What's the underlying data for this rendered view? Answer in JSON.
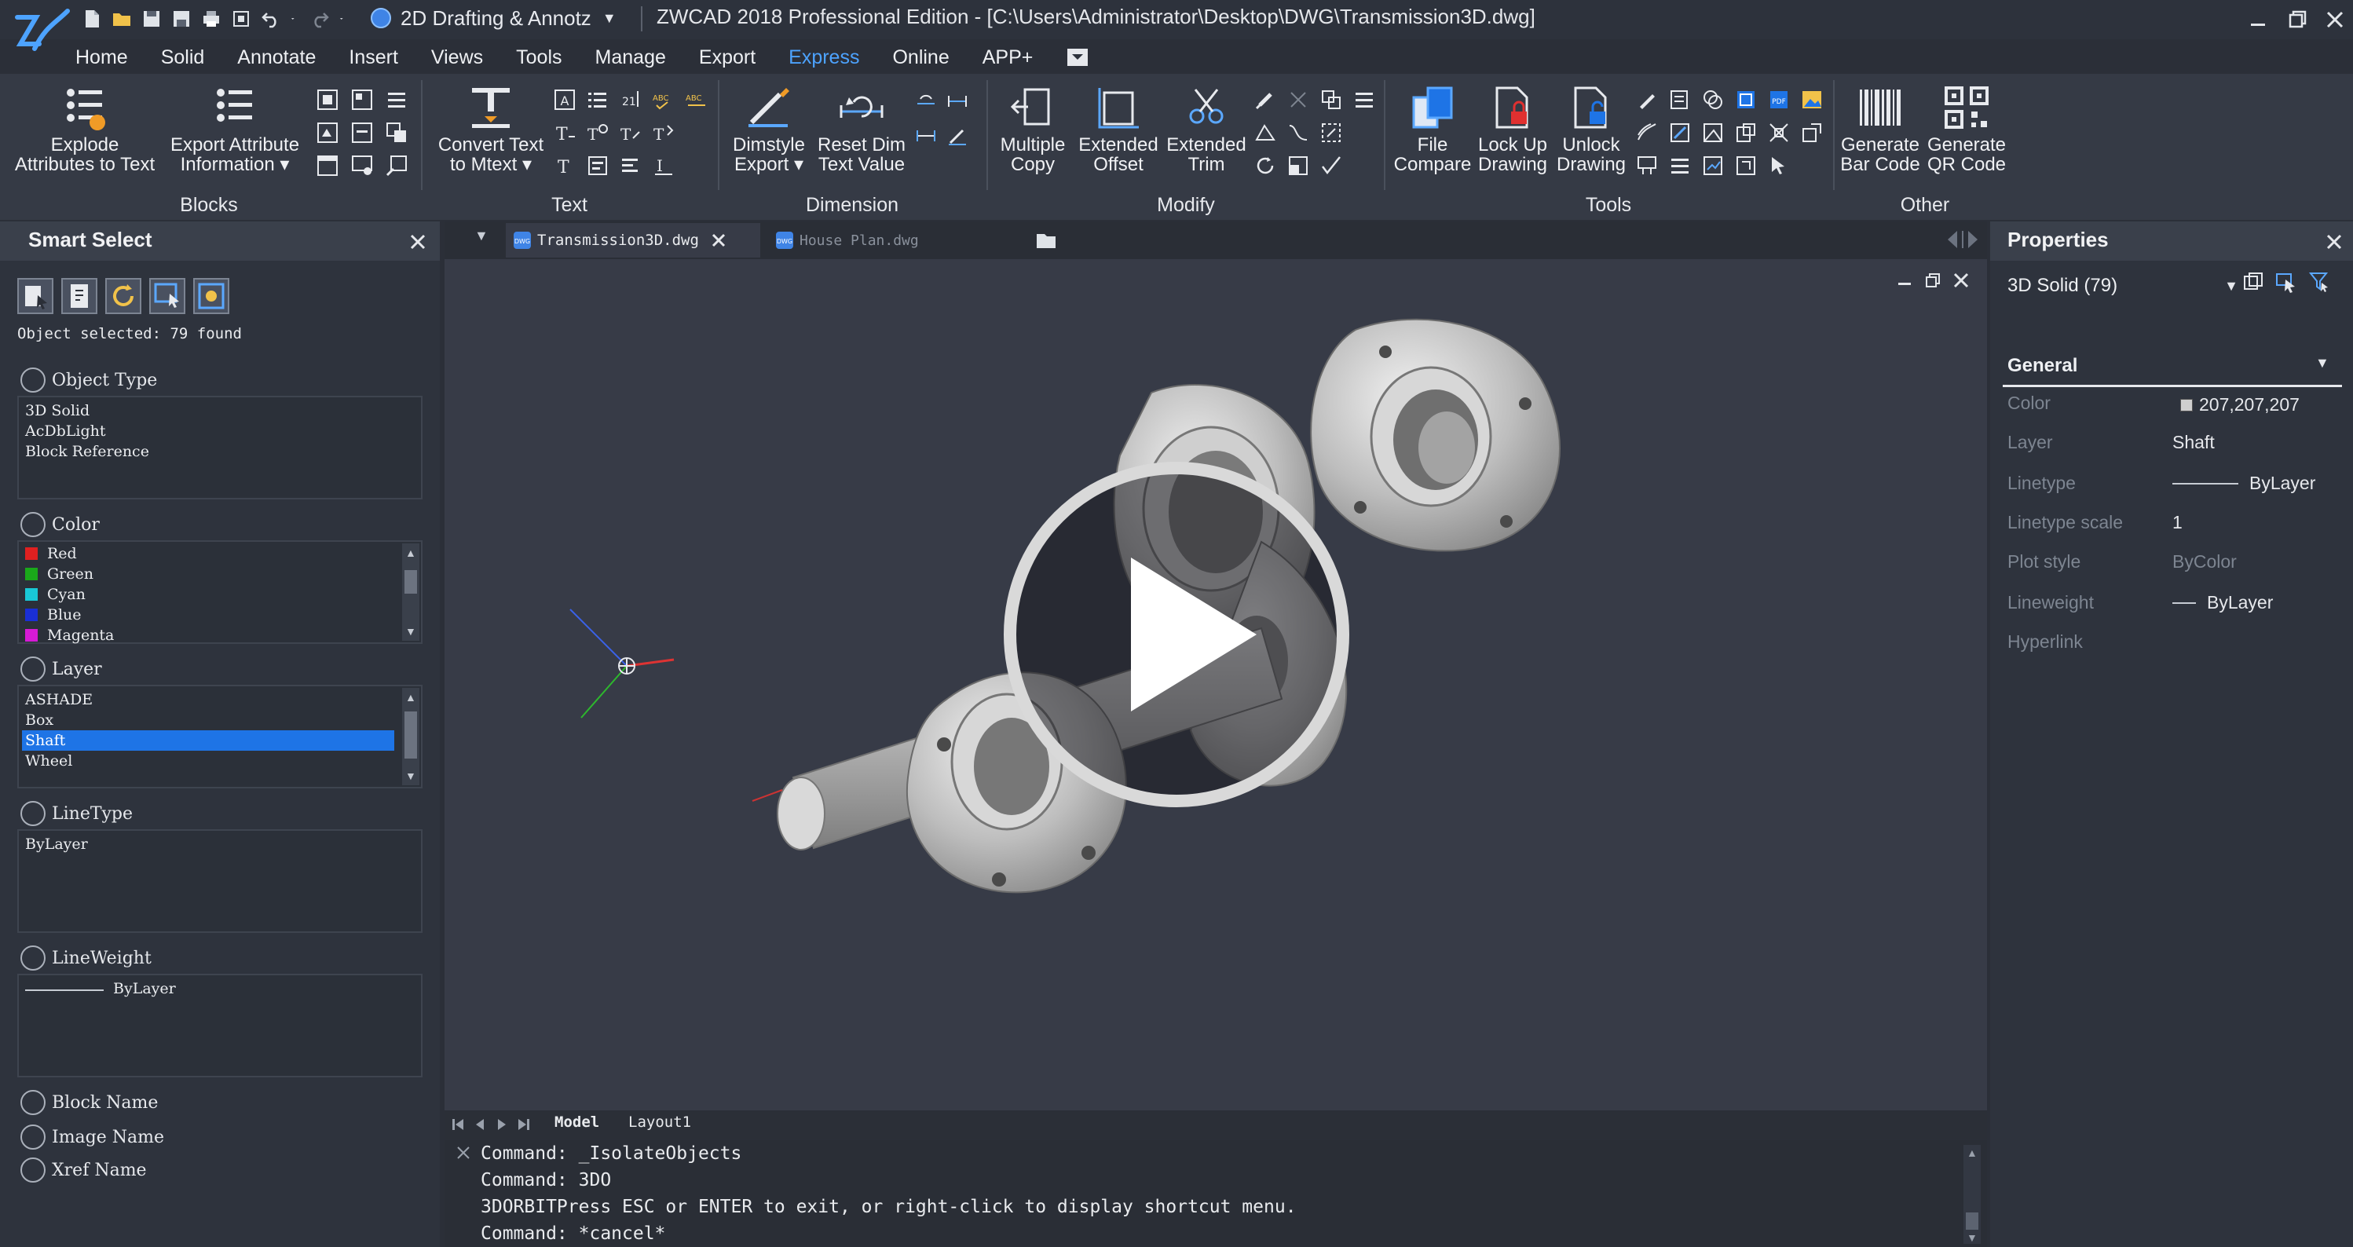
{
  "app": {
    "workspace": "2D Drafting & Annotz",
    "title": "ZWCAD 2018 Professional Edition - [C:\\Users\\Administrator\\Desktop\\DWG\\Transmission3D.dwg]"
  },
  "menu": {
    "items": [
      "Home",
      "Solid",
      "Annotate",
      "Insert",
      "Views",
      "Tools",
      "Manage",
      "Export",
      "Express",
      "Online",
      "APP+"
    ],
    "active": "Express"
  },
  "ribbon": {
    "blocks": {
      "label": "Blocks",
      "explode_line1": "Explode",
      "explode_line2": "Attributes to Text",
      "export_line1": "Export Attribute",
      "export_line2": "Information ▾"
    },
    "text": {
      "label": "Text",
      "convert_line1": "Convert Text",
      "convert_line2": "to Mtext ▾"
    },
    "dimension": {
      "label": "Dimension",
      "dimstyle_line1": "Dimstyle",
      "dimstyle_line2": "Export ▾",
      "reset_line1": "Reset Dim",
      "reset_line2": "Text Value"
    },
    "modify": {
      "label": "Modify",
      "multiple_line1": "Multiple",
      "multiple_line2": "Copy",
      "offset_line1": "Extended",
      "offset_line2": "Offset",
      "trim_line1": "Extended",
      "trim_line2": "Trim"
    },
    "tools": {
      "label": "Tools",
      "compare_line1": "File",
      "compare_line2": "Compare",
      "lock_line1": "Lock Up",
      "lock_line2": "Drawing",
      "unlock_line1": "Unlock",
      "unlock_line2": "Drawing"
    },
    "other": {
      "label": "Other",
      "barcode_line1": "Generate",
      "barcode_line2": "Bar Code",
      "qr_line1": "Generate",
      "qr_line2": "QR Code"
    }
  },
  "smart_select": {
    "title": "Smart Select",
    "status": "Object selected: 79 found",
    "object_type": {
      "label": "Object Type",
      "items": [
        "3D Solid",
        "AcDbLight",
        "Block Reference"
      ]
    },
    "color": {
      "label": "Color",
      "items": [
        {
          "name": "Red",
          "hex": "#e02020"
        },
        {
          "name": "Green",
          "hex": "#1aa81a"
        },
        {
          "name": "Cyan",
          "hex": "#19c8d6"
        },
        {
          "name": "Blue",
          "hex": "#1a2fd6"
        },
        {
          "name": "Magenta",
          "hex": "#d61ad6"
        }
      ]
    },
    "layer": {
      "label": "Layer",
      "items": [
        "ASHADE",
        "Box",
        "Shaft",
        "Wheel"
      ],
      "selected": "Shaft"
    },
    "linetype": {
      "label": "LineType",
      "value": "ByLayer"
    },
    "lineweight": {
      "label": "LineWeight",
      "value": "ByLayer"
    },
    "block_name": "Block Name",
    "image_name": "Image Name",
    "xref_name": "Xref Name"
  },
  "tabs": {
    "items": [
      "Transmission3D.dwg",
      "House Plan.dwg"
    ],
    "active": "Transmission3D.dwg"
  },
  "layout_tabs": {
    "model": "Model",
    "layout": "Layout1"
  },
  "command_lines": [
    "Command: _IsolateObjects",
    "Command: 3DO",
    "3DORBITPress ESC or ENTER to exit, or right-click to display shortcut menu.",
    "Command: *cancel*"
  ],
  "properties": {
    "title": "Properties",
    "selection": "3D Solid (79)",
    "section": "General",
    "rows": [
      {
        "key": "Color",
        "value": "207,207,207"
      },
      {
        "key": "Layer",
        "value": "Shaft"
      },
      {
        "key": "Linetype",
        "value": "ByLayer"
      },
      {
        "key": "Linetype scale",
        "value": "1"
      },
      {
        "key": "Plot style",
        "value": "ByColor"
      },
      {
        "key": "Lineweight",
        "value": "ByLayer"
      },
      {
        "key": "Hyperlink",
        "value": ""
      }
    ],
    "color_hex": "#cfcfcf"
  },
  "colors": {
    "accent": "#4da3ff",
    "selection": "#1e74e6"
  }
}
